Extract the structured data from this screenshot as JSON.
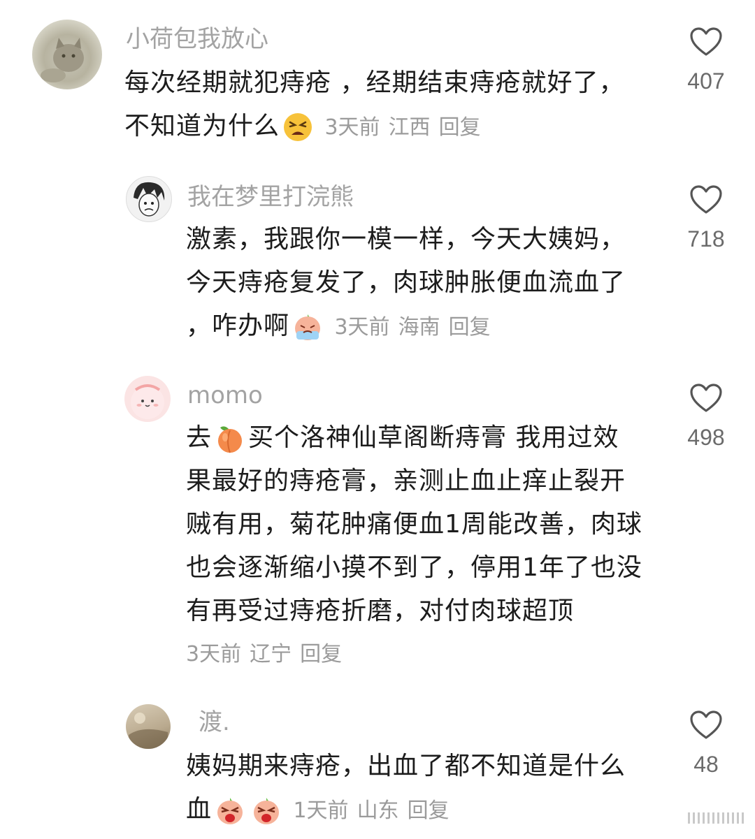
{
  "comments": [
    {
      "username": "小荷包我放心",
      "lines": [
        "每次经期就犯痔疮 ，经期结束痔疮就好了，",
        "不知道为什么"
      ],
      "emojis": [
        "tired-face-emoji"
      ],
      "time": "3天前",
      "location": "江西",
      "reply": "回复",
      "likes": "407"
    },
    {
      "username": "我在梦里打浣熊",
      "lines": [
        "激素，我跟你一模一样，今天大姨妈，",
        "今天痔疮复发了，肉球肿胀便血流血了",
        "，咋办啊"
      ],
      "emojis": [
        "peach-crying-emoji"
      ],
      "time": "3天前",
      "location": "海南",
      "reply": "回复",
      "likes": "718"
    },
    {
      "username": "momo",
      "line1_a": "去",
      "line1_b": "买个洛神仙草阁断痔膏 我用过效",
      "lines": [
        "果最好的痔疮膏，亲测止血止痒止裂开",
        "贼有用，菊花肿痛便血1周能改善，肉球",
        "也会逐渐缩小摸不到了，停用1年了也没",
        "有再受过痔疮折磨，对付肉球超顶"
      ],
      "emojis": [
        "peach-emoji"
      ],
      "time": "3天前",
      "location": "辽宁",
      "reply": "回复",
      "likes": "498"
    },
    {
      "username": "渡.",
      "lines": [
        "姨妈期来痔疮，出血了都不知道是什么",
        "血"
      ],
      "emojis": [
        "peach-shouting-emoji",
        "peach-shouting-emoji"
      ],
      "time": "1天前",
      "location": "山东",
      "reply": "回复",
      "likes": "48"
    }
  ],
  "icons": {
    "like": "heart-outline-icon"
  },
  "colors": {
    "username": "#a3a3a3",
    "body": "#1c1c1c",
    "meta": "#9b9b9b",
    "like_count": "#6b6b6b"
  }
}
